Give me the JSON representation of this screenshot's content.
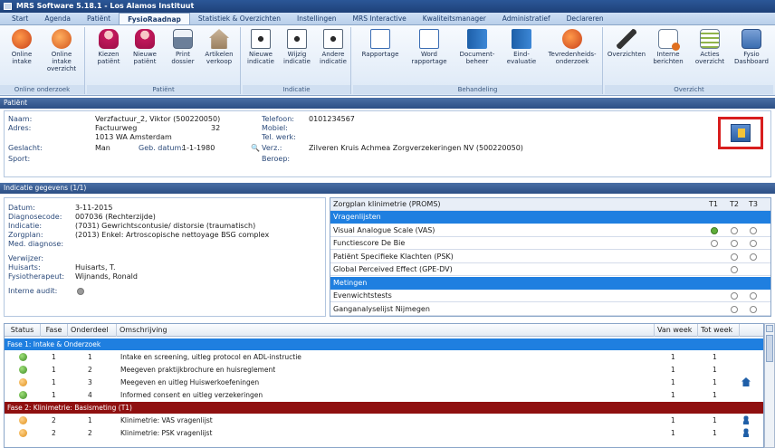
{
  "window": {
    "title": "MRS Software 5.18.1 - Los Alamos Instituut"
  },
  "tabs": [
    {
      "label": "Start"
    },
    {
      "label": "Agenda"
    },
    {
      "label": "Patiënt"
    },
    {
      "label": "FysioRaadnap",
      "active": true
    },
    {
      "label": "Statistiek & Overzichten"
    },
    {
      "label": "Instellingen"
    },
    {
      "label": "MRS Interactive"
    },
    {
      "label": "Kwaliteitsmanager"
    },
    {
      "label": "Administratief"
    },
    {
      "label": "Declareren"
    }
  ],
  "ribbon": {
    "groups": [
      {
        "title": "Online onderzoek",
        "buttons": [
          {
            "label": "Online intake",
            "icon": "globe-icon"
          },
          {
            "label": "Online intake overzicht",
            "icon": "globe-icon"
          }
        ]
      },
      {
        "title": "Patiënt",
        "buttons": [
          {
            "label": "Kiezen patiënt",
            "icon": "person-icon"
          },
          {
            "label": "Nieuwe patiënt",
            "icon": "person-add-icon"
          },
          {
            "label": "Print dossier",
            "icon": "printer-icon"
          },
          {
            "label": "Artikelen verkoop",
            "icon": "house-icon"
          }
        ]
      },
      {
        "title": "Indicatie",
        "buttons": [
          {
            "label": "Nieuwe indicatie",
            "icon": "document-icon"
          },
          {
            "label": "Wijzig indicatie",
            "icon": "document-icon"
          },
          {
            "label": "Andere indicatie",
            "icon": "document-icon"
          }
        ]
      },
      {
        "title": "Behandeling",
        "buttons": [
          {
            "label": "Rapportage",
            "icon": "report-icon"
          },
          {
            "label": "Word rapportage",
            "icon": "word-icon"
          },
          {
            "label": "Document-beheer",
            "icon": "book-icon"
          },
          {
            "label": "Eind-evaluatie",
            "icon": "book-icon"
          },
          {
            "label": "Tevredenheids-onderzoek",
            "icon": "survey-icon"
          }
        ]
      },
      {
        "title": "Overzicht",
        "buttons": [
          {
            "label": "Overzichten",
            "icon": "tool-icon"
          },
          {
            "label": "Interne berichten",
            "icon": "mail-icon"
          },
          {
            "label": "Acties overzicht",
            "icon": "list-icon"
          },
          {
            "label": "Fysio Dashboard",
            "icon": "dashboard-icon"
          }
        ]
      }
    ]
  },
  "patient": {
    "section_title": "Patiënt",
    "naam_label": "Naam:",
    "naam": "Verzfactuur_2, Viktor (500220050)",
    "adres_label": "Adres:",
    "adres_straat": "Factuurweg",
    "adres_nr": "32",
    "adres_plaats": "1013 WA   Amsterdam",
    "geslacht_label": "Geslacht:",
    "geslacht": "Man",
    "geb_label": "Geb. datum:",
    "geb_datum": "1-1-1980",
    "sport_label": "Sport:",
    "telefoon_label": "Telefoon:",
    "telefoon": "0101234567",
    "mobiel_label": "Mobiel:",
    "telwerk_label": "Tel. werk:",
    "verz_label": "Verz.:",
    "verzekeraar": "Zilveren Kruis Achmea Zorgverzekeringen NV (500220050)",
    "beroep_label": "Beroep:"
  },
  "indicatie": {
    "section_title": "Indicatie gegevens (1/1)",
    "datum_label": "Datum:",
    "datum": "3-11-2015",
    "diagnose_label": "Diagnosecode:",
    "diagnose": "007036 (Rechterzijde)",
    "indicatie_label": "Indicatie:",
    "indicatie": "(7031) Gewrichtscontusie/ distorsie (traumatisch)",
    "zorgplan_label": "Zorgplan:",
    "zorgplan": "(2013) Enkel: Artroscopische nettoyage BSG complex",
    "med_label": "Med. diagnose:",
    "verwijzer_label": "Verwijzer:",
    "huisarts_label": "Huisarts:",
    "huisarts": "Huisarts, T.",
    "fysio_label": "Fysiotherapeut:",
    "fysio": "Wijnands, Ronald",
    "audit_label": "Interne audit:"
  },
  "zorgplan_table": {
    "title": "Zorgplan klinimetrie (PROMS)",
    "cols": [
      "T1",
      "T2",
      "T3"
    ],
    "rows": [
      {
        "type": "sub",
        "label": "Vragenlijsten"
      },
      {
        "type": "item",
        "label": "Visual Analogue Scale (VAS)",
        "t1": "done",
        "t2": "open",
        "t3": "open"
      },
      {
        "type": "item",
        "label": "Functiescore De Bie",
        "t1": "open",
        "t2": "open",
        "t3": "open"
      },
      {
        "type": "item",
        "label": "Patiënt Specifieke Klachten (PSK)",
        "t1": "",
        "t2": "open",
        "t3": "open"
      },
      {
        "type": "item",
        "label": "Global Perceived Effect (GPE-DV)",
        "t1": "",
        "t2": "open",
        "t3": ""
      },
      {
        "type": "sub",
        "label": "Metingen"
      },
      {
        "type": "item",
        "label": "Evenwichtstests",
        "t1": "",
        "t2": "open",
        "t3": "open"
      },
      {
        "type": "item",
        "label": "Ganganalyselijst Nijmegen",
        "t1": "",
        "t2": "open",
        "t3": "open"
      }
    ]
  },
  "grid": {
    "headers": [
      "Status",
      "Fase",
      "Onderdeel",
      "Omschrijving",
      "Van week",
      "Tot week"
    ],
    "phases": [
      {
        "title": "Fase 1: Intake & Onderzoek",
        "rows": [
          {
            "status": "green",
            "fase": "1",
            "onderdeel": "1",
            "omschrijving": "Intake en screening, uitleg protocol en ADL-instructie",
            "van": "1",
            "tot": "1",
            "icon": ""
          },
          {
            "status": "green",
            "fase": "1",
            "onderdeel": "2",
            "omschrijving": "Meegeven praktijkbrochure en huisreglement",
            "van": "1",
            "tot": "1",
            "icon": ""
          },
          {
            "status": "orange",
            "fase": "1",
            "onderdeel": "3",
            "omschrijving": "Meegeven en uitleg Huiswerkoefeningen",
            "van": "1",
            "tot": "1",
            "icon": "home-icon"
          },
          {
            "status": "green",
            "fase": "1",
            "onderdeel": "4",
            "omschrijving": "Informed consent en uitleg verzekeringen",
            "van": "1",
            "tot": "1",
            "icon": ""
          }
        ]
      },
      {
        "title": "Fase 2: Klinimetrie: Basismeting (T1)",
        "rows": [
          {
            "status": "orange",
            "fase": "2",
            "onderdeel": "1",
            "omschrijving": "Klinimetrie: VAS vragenlijst",
            "van": "1",
            "tot": "1",
            "icon": "person-icon"
          },
          {
            "status": "orange",
            "fase": "2",
            "onderdeel": "2",
            "omschrijving": "Klinimetrie: PSK vragenlijst",
            "van": "1",
            "tot": "1",
            "icon": "person-icon"
          }
        ]
      }
    ]
  }
}
